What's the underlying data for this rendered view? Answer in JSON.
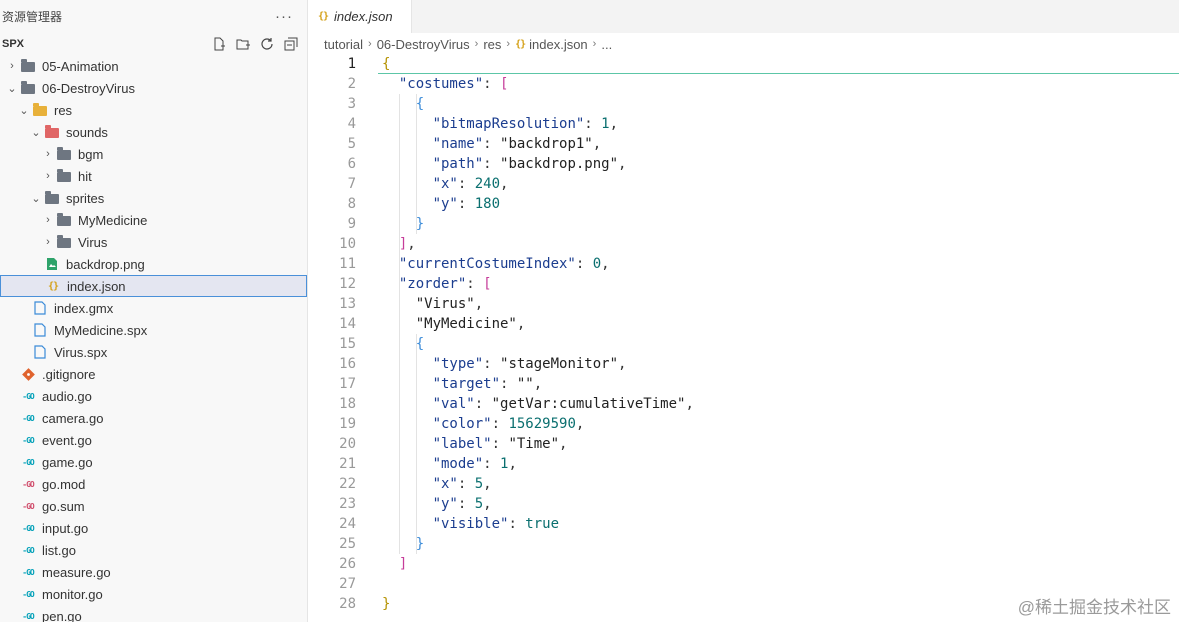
{
  "explorer": {
    "title": "资源管理器",
    "more": "···",
    "root": "SPX",
    "tree": [
      {
        "label": "05-Animation",
        "depth": 0,
        "type": "folder",
        "chevron": "›"
      },
      {
        "label": "06-DestroyVirus",
        "depth": 0,
        "type": "folder",
        "chevron": "⌄"
      },
      {
        "label": "res",
        "depth": 1,
        "type": "folder-res",
        "chevron": "⌄"
      },
      {
        "label": "sounds",
        "depth": 2,
        "type": "folder-sounds",
        "chevron": "⌄"
      },
      {
        "label": "bgm",
        "depth": 3,
        "type": "folder",
        "chevron": "›"
      },
      {
        "label": "hit",
        "depth": 3,
        "type": "folder",
        "chevron": "›"
      },
      {
        "label": "sprites",
        "depth": 2,
        "type": "folder",
        "chevron": "⌄"
      },
      {
        "label": "MyMedicine",
        "depth": 3,
        "type": "folder",
        "chevron": "›"
      },
      {
        "label": "Virus",
        "depth": 3,
        "type": "folder",
        "chevron": "›"
      },
      {
        "label": "backdrop.png",
        "depth": 2,
        "type": "image",
        "chevron": ""
      },
      {
        "label": "index.json",
        "depth": 2,
        "type": "json",
        "chevron": "",
        "selected": true
      },
      {
        "label": "index.gmx",
        "depth": 1,
        "type": "file",
        "chevron": ""
      },
      {
        "label": "MyMedicine.spx",
        "depth": 1,
        "type": "file",
        "chevron": ""
      },
      {
        "label": "Virus.spx",
        "depth": 1,
        "type": "file",
        "chevron": ""
      },
      {
        "label": ".gitignore",
        "depth": 0,
        "type": "git",
        "chevron": ""
      },
      {
        "label": "audio.go",
        "depth": 0,
        "type": "go",
        "chevron": ""
      },
      {
        "label": "camera.go",
        "depth": 0,
        "type": "go",
        "chevron": ""
      },
      {
        "label": "event.go",
        "depth": 0,
        "type": "go",
        "chevron": ""
      },
      {
        "label": "game.go",
        "depth": 0,
        "type": "go",
        "chevron": ""
      },
      {
        "label": "go.mod",
        "depth": 0,
        "type": "gomod",
        "chevron": ""
      },
      {
        "label": "go.sum",
        "depth": 0,
        "type": "gomod",
        "chevron": ""
      },
      {
        "label": "input.go",
        "depth": 0,
        "type": "go",
        "chevron": ""
      },
      {
        "label": "list.go",
        "depth": 0,
        "type": "go",
        "chevron": ""
      },
      {
        "label": "measure.go",
        "depth": 0,
        "type": "go",
        "chevron": ""
      },
      {
        "label": "monitor.go",
        "depth": 0,
        "type": "go",
        "chevron": ""
      },
      {
        "label": "pen.go",
        "depth": 0,
        "type": "go",
        "chevron": ""
      }
    ]
  },
  "editor": {
    "tab": "index.json",
    "breadcrumb": [
      "tutorial",
      "06-DestroyVirus",
      "res",
      "index.json",
      "..."
    ],
    "active_line": 1,
    "lines": [
      [
        {
          "t": "{",
          "c": "b1"
        }
      ],
      [
        {
          "t": "  "
        },
        {
          "t": "\"costumes\"",
          "c": "k"
        },
        {
          "t": ": "
        },
        {
          "t": "[",
          "c": "b2"
        }
      ],
      [
        {
          "t": "    "
        },
        {
          "t": "{",
          "c": "b3"
        }
      ],
      [
        {
          "t": "      "
        },
        {
          "t": "\"bitmapResolution\"",
          "c": "k"
        },
        {
          "t": ": "
        },
        {
          "t": "1",
          "c": "n"
        },
        {
          "t": ","
        }
      ],
      [
        {
          "t": "      "
        },
        {
          "t": "\"name\"",
          "c": "k"
        },
        {
          "t": ": "
        },
        {
          "t": "\"backdrop1\"",
          "c": "s"
        },
        {
          "t": ","
        }
      ],
      [
        {
          "t": "      "
        },
        {
          "t": "\"path\"",
          "c": "k"
        },
        {
          "t": ": "
        },
        {
          "t": "\"backdrop.png\"",
          "c": "s"
        },
        {
          "t": ","
        }
      ],
      [
        {
          "t": "      "
        },
        {
          "t": "\"x\"",
          "c": "k"
        },
        {
          "t": ": "
        },
        {
          "t": "240",
          "c": "n"
        },
        {
          "t": ","
        }
      ],
      [
        {
          "t": "      "
        },
        {
          "t": "\"y\"",
          "c": "k"
        },
        {
          "t": ": "
        },
        {
          "t": "180",
          "c": "n"
        }
      ],
      [
        {
          "t": "    "
        },
        {
          "t": "}",
          "c": "b3"
        }
      ],
      [
        {
          "t": "  "
        },
        {
          "t": "]",
          "c": "b2"
        },
        {
          "t": ","
        }
      ],
      [
        {
          "t": "  "
        },
        {
          "t": "\"currentCostumeIndex\"",
          "c": "k"
        },
        {
          "t": ": "
        },
        {
          "t": "0",
          "c": "n"
        },
        {
          "t": ","
        }
      ],
      [
        {
          "t": "  "
        },
        {
          "t": "\"zorder\"",
          "c": "k"
        },
        {
          "t": ": "
        },
        {
          "t": "[",
          "c": "b2"
        }
      ],
      [
        {
          "t": "    "
        },
        {
          "t": "\"Virus\"",
          "c": "s"
        },
        {
          "t": ","
        }
      ],
      [
        {
          "t": "    "
        },
        {
          "t": "\"MyMedicine\"",
          "c": "s"
        },
        {
          "t": ","
        }
      ],
      [
        {
          "t": "    "
        },
        {
          "t": "{",
          "c": "b3"
        }
      ],
      [
        {
          "t": "      "
        },
        {
          "t": "\"type\"",
          "c": "k"
        },
        {
          "t": ": "
        },
        {
          "t": "\"stageMonitor\"",
          "c": "s"
        },
        {
          "t": ","
        }
      ],
      [
        {
          "t": "      "
        },
        {
          "t": "\"target\"",
          "c": "k"
        },
        {
          "t": ": "
        },
        {
          "t": "\"\"",
          "c": "s"
        },
        {
          "t": ","
        }
      ],
      [
        {
          "t": "      "
        },
        {
          "t": "\"val\"",
          "c": "k"
        },
        {
          "t": ": "
        },
        {
          "t": "\"getVar:cumulativeTime\"",
          "c": "s"
        },
        {
          "t": ","
        }
      ],
      [
        {
          "t": "      "
        },
        {
          "t": "\"color\"",
          "c": "k"
        },
        {
          "t": ": "
        },
        {
          "t": "15629590",
          "c": "n"
        },
        {
          "t": ","
        }
      ],
      [
        {
          "t": "      "
        },
        {
          "t": "\"label\"",
          "c": "k"
        },
        {
          "t": ": "
        },
        {
          "t": "\"Time\"",
          "c": "s"
        },
        {
          "t": ","
        }
      ],
      [
        {
          "t": "      "
        },
        {
          "t": "\"mode\"",
          "c": "k"
        },
        {
          "t": ": "
        },
        {
          "t": "1",
          "c": "n"
        },
        {
          "t": ","
        }
      ],
      [
        {
          "t": "      "
        },
        {
          "t": "\"x\"",
          "c": "k"
        },
        {
          "t": ": "
        },
        {
          "t": "5",
          "c": "n"
        },
        {
          "t": ","
        }
      ],
      [
        {
          "t": "      "
        },
        {
          "t": "\"y\"",
          "c": "k"
        },
        {
          "t": ": "
        },
        {
          "t": "5",
          "c": "n"
        },
        {
          "t": ","
        }
      ],
      [
        {
          "t": "      "
        },
        {
          "t": "\"visible\"",
          "c": "k"
        },
        {
          "t": ": "
        },
        {
          "t": "true",
          "c": "kw"
        }
      ],
      [
        {
          "t": "    "
        },
        {
          "t": "}",
          "c": "b3"
        }
      ],
      [
        {
          "t": "  "
        },
        {
          "t": "]",
          "c": "b2"
        }
      ],
      [],
      [
        {
          "t": "}",
          "c": "b1"
        }
      ]
    ]
  },
  "watermark": "@稀土掘金技术社区"
}
